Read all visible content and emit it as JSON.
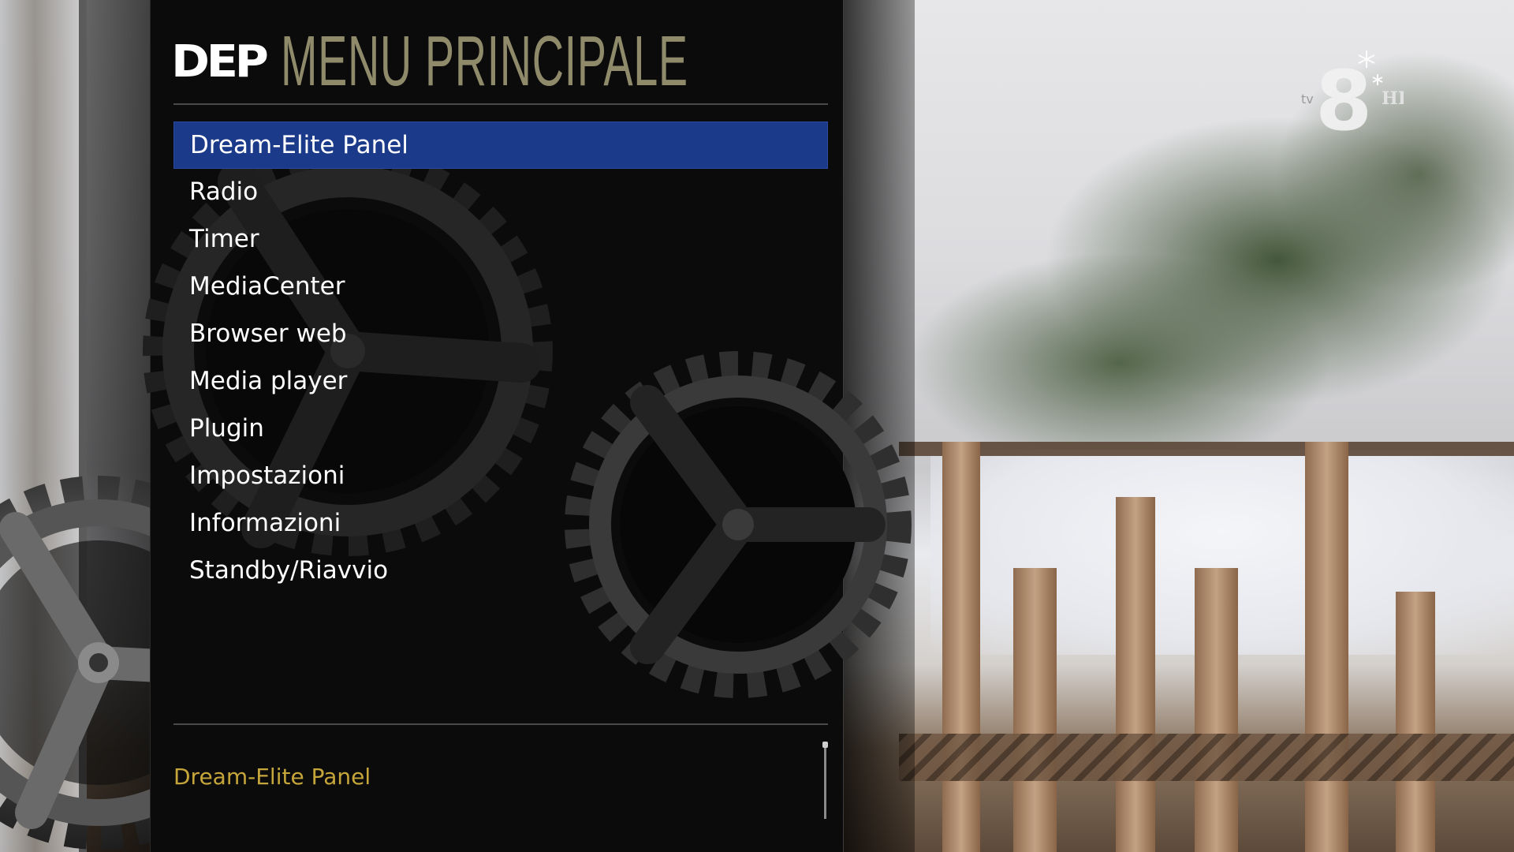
{
  "header": {
    "logo_text": "DEP",
    "title": "MENU PRINCIPALE"
  },
  "menu": {
    "items": [
      {
        "label": "Dream-Elite Panel",
        "selected": true
      },
      {
        "label": "Radio",
        "selected": false
      },
      {
        "label": "Timer",
        "selected": false
      },
      {
        "label": "MediaCenter",
        "selected": false
      },
      {
        "label": "Browser web",
        "selected": false
      },
      {
        "label": "Media player",
        "selected": false
      },
      {
        "label": "Plugin",
        "selected": false
      },
      {
        "label": "Impostazioni",
        "selected": false
      },
      {
        "label": "Informazioni",
        "selected": false
      },
      {
        "label": "Standby/Riavvio",
        "selected": false
      }
    ]
  },
  "footer": {
    "description": "Dream-Elite Panel"
  },
  "channel_logo": {
    "number": "8",
    "prefix": "tv",
    "suffix": "HD",
    "icon": "snowflake-icon"
  },
  "colors": {
    "selection": "#1c3a8a",
    "title": "#8f8a6a",
    "description": "#c6a63a",
    "panel": "#0b0b0b"
  }
}
